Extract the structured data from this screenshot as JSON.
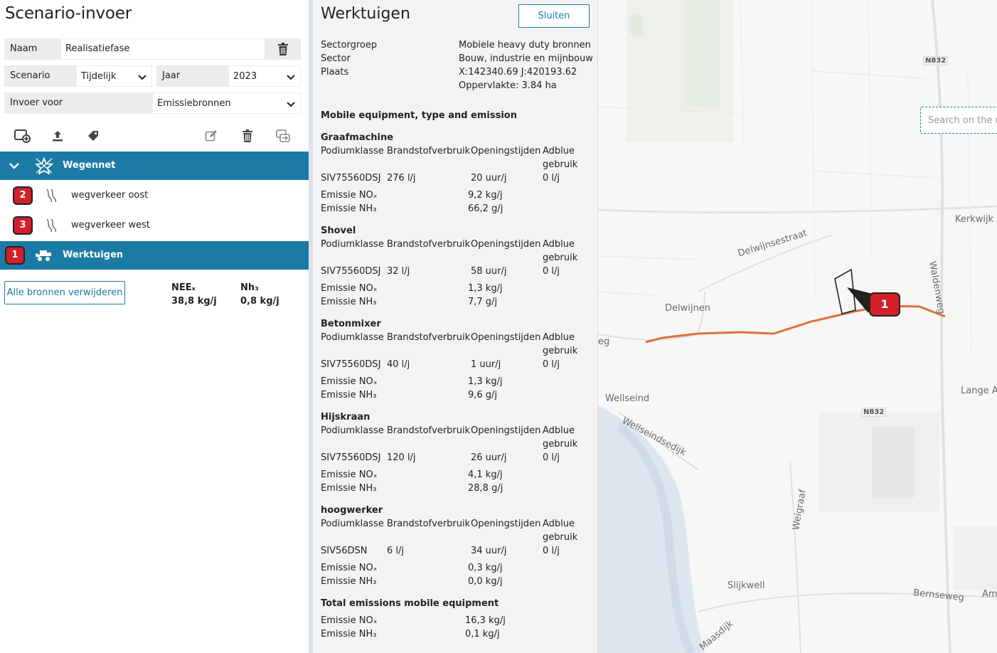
{
  "left": {
    "title": "Scenario-invoer",
    "fields": {
      "name_label": "Naam",
      "name_value": "Realisatiefase",
      "scenario_label": "Scenario",
      "scenario_value": "Tijdelijk",
      "year_label": "Jaar",
      "year_value": "2023",
      "input_label": "Invoer voor",
      "input_value": "Emissiebronnen"
    },
    "toolbar": [
      "add-source-icon",
      "upload-icon",
      "tag-icon",
      "edit-icon",
      "trash-icon",
      "copy-icon"
    ],
    "groups": [
      {
        "label": "Wegennet",
        "icon": "road-network-icon"
      },
      {
        "label": "Werktuigen",
        "icon": "machinery-icon",
        "badge": "1"
      }
    ],
    "sources": [
      {
        "badge": "2",
        "label": "wegverkeer oost",
        "icon": "road-icon"
      },
      {
        "badge": "3",
        "label": "wegverkeer west",
        "icon": "road-icon"
      }
    ],
    "remove_all_label": "Alle bronnen verwijderen",
    "totals": [
      {
        "name": "NEEₓ",
        "value": "38,8 kg/j"
      },
      {
        "name": "Nh₃",
        "value": "0,8 kg/j"
      }
    ]
  },
  "detail": {
    "title": "Werktuigen",
    "close_label": "Sluiten",
    "meta_keys": [
      "Sectorgroep",
      "Sector",
      "Plaats"
    ],
    "meta_values": [
      "Mobiele heavy duty bronnen",
      "Bouw, industrie en mijnbouw",
      "X:142340.69 J:420193.62",
      "Oppervlakte: 3.84 ha"
    ],
    "section_title": "Mobile equipment, type and emission",
    "headers": {
      "class": "Podiumklasse",
      "fuel": "Brandstofverbruik",
      "hours": "Openingstijden",
      "adblue_1": "Adblue",
      "adblue_2": "gebruik"
    },
    "emission_labels": {
      "nox": "Emissie NOₓ",
      "nh3": "Emissie NH₃"
    },
    "machines": [
      {
        "name": "Graafmachine",
        "code": "SIV75560DSJ",
        "fuel": "276 l/j",
        "hours": "20 uur/j",
        "adblue": "0 l/j",
        "nox": "9,2 kg/j",
        "nh3": "66,2 g/j"
      },
      {
        "name": "Shovel",
        "code": "SIV75560DSJ",
        "fuel": "32 l/j",
        "hours": "58 uur/j",
        "adblue": "0 l/j",
        "nox": "1,3 kg/j",
        "nh3": "7,7 g/j"
      },
      {
        "name": "Betonmixer",
        "code": "SIV75560DSJ",
        "fuel": "40 l/j",
        "hours": "1 uur/j",
        "adblue": "0 l/j",
        "nox": "1,3 kg/j",
        "nh3": "9,6 g/j"
      },
      {
        "name": "Hijskraan",
        "code": "SIV75560DSJ",
        "fuel": "120 l/j",
        "hours": "26 uur/j",
        "adblue": "0 l/j",
        "nox": "4,1 kg/j",
        "nh3": "28,8 g/j"
      },
      {
        "name": "hoogwerker",
        "code": "SIV56DSN",
        "fuel": "6 l/j",
        "hours": "34 uur/j",
        "adblue": "0 l/j",
        "nox": "0,3 kg/j",
        "nh3": "0,0 kg/j"
      }
    ],
    "total_title": "Total emissions mobile equipment",
    "total_nox": "16,3 kg/j",
    "total_nh3": "0,1 kg/j"
  },
  "map": {
    "search_placeholder": "Search on the map",
    "badge": "1",
    "labels": {
      "n832_top": "N832",
      "n832_mid": "N832",
      "kerkwijk": "Kerkwijk",
      "delwijnsestraat": "Delwijnsestraat",
      "waldenweg": "Waldenweg",
      "delwijnen": "Delwijnen",
      "eg": "eg",
      "wellseind": "Wellseind",
      "wellseindsedijk": "Wellseindsedijk",
      "lange": "Lange A",
      "weigraaf": "Weigraaf",
      "slijkwell": "Slijkwell",
      "bernseweg": "Bernseweg",
      "am": "Am",
      "maasdijk": "Maasdijk"
    },
    "colors": {
      "route": "#e0703a",
      "accent": "#1b7ba5",
      "badge": "#d31f2a"
    }
  }
}
